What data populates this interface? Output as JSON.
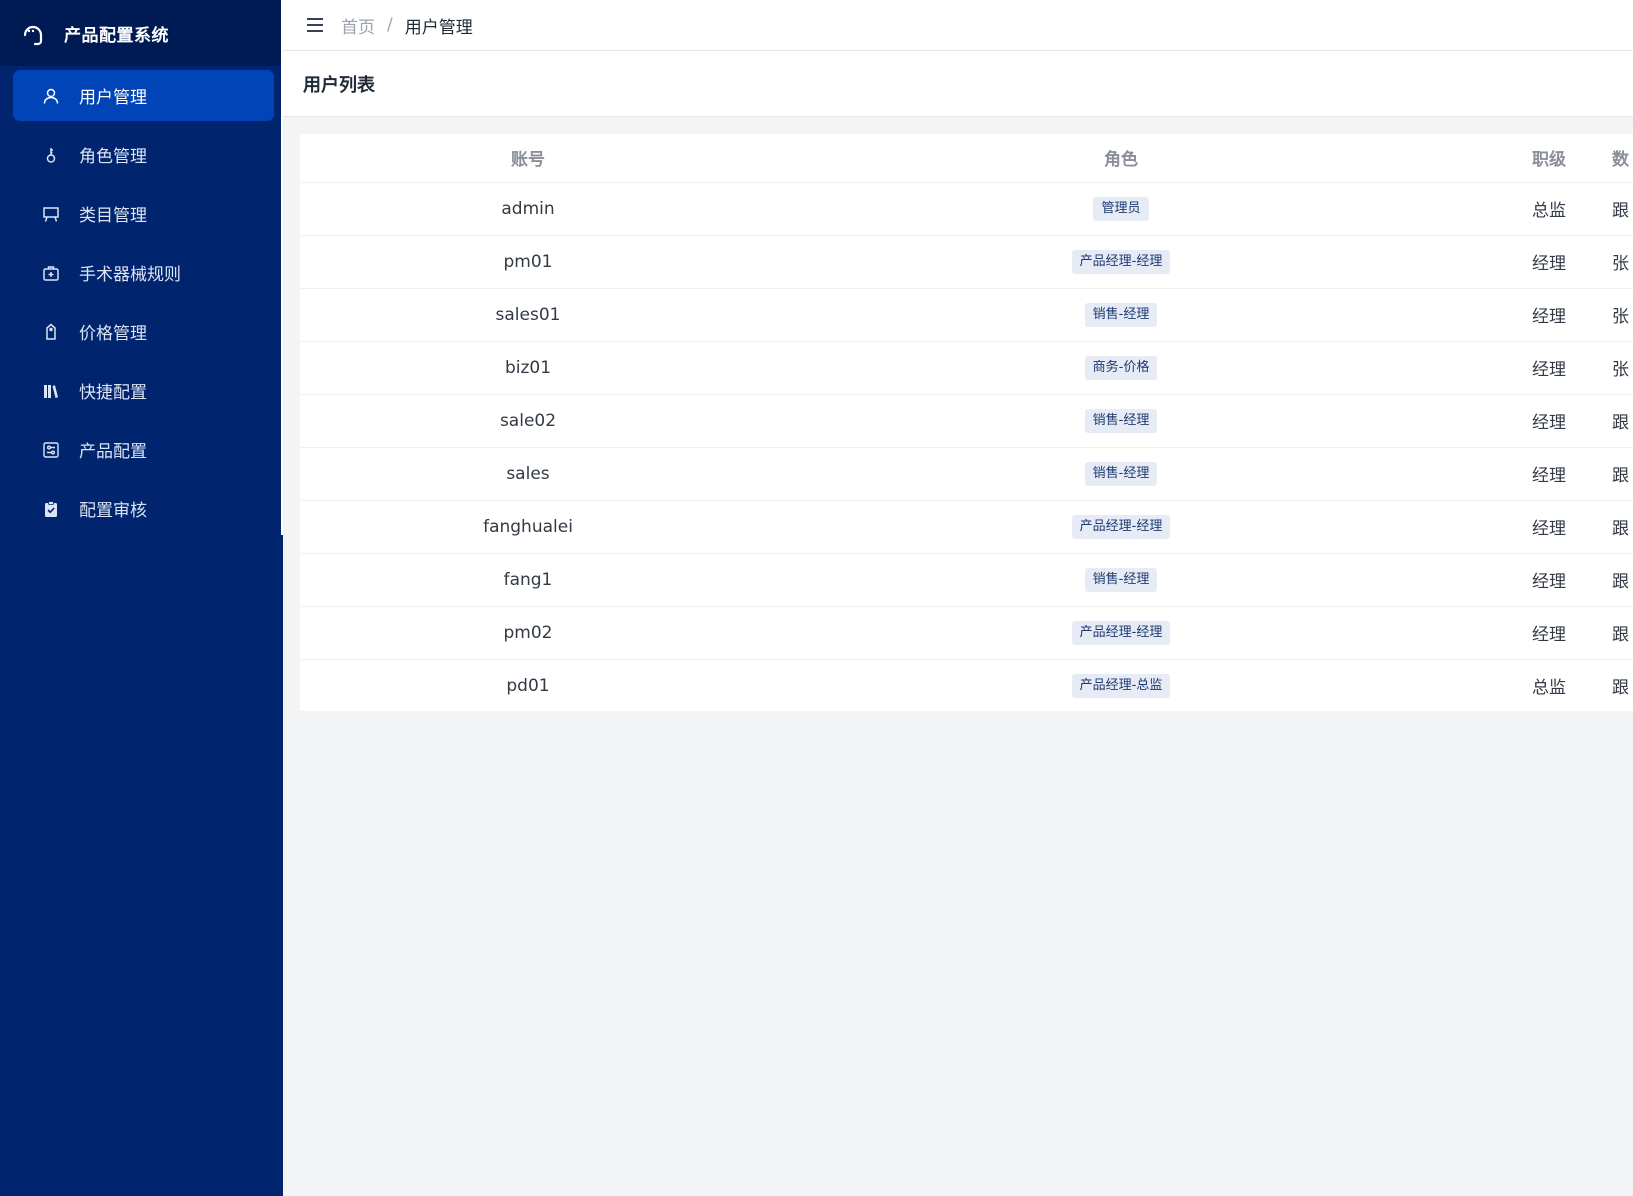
{
  "app": {
    "title": "产品配置系统"
  },
  "sidebar": {
    "items": [
      {
        "label": "用户管理",
        "icon": "user-icon",
        "active": true
      },
      {
        "label": "角色管理",
        "icon": "key-icon",
        "active": false
      },
      {
        "label": "类目管理",
        "icon": "easel-icon",
        "active": false
      },
      {
        "label": "手术器械规则",
        "icon": "medical-kit-icon",
        "active": false
      },
      {
        "label": "价格管理",
        "icon": "price-tag-icon",
        "active": false
      },
      {
        "label": "快捷配置",
        "icon": "books-icon",
        "active": false
      },
      {
        "label": "产品配置",
        "icon": "sliders-icon",
        "active": false
      },
      {
        "label": "配置审核",
        "icon": "clipboard-check-icon",
        "active": false
      }
    ]
  },
  "header": {
    "breadcrumb": {
      "home": "首页",
      "separator": "/",
      "current": "用户管理"
    }
  },
  "page": {
    "title": "用户列表"
  },
  "table": {
    "columns": [
      "账号",
      "角色",
      "职级",
      "数"
    ],
    "rows": [
      {
        "account": "admin",
        "role": "管理员",
        "level": "总监",
        "extra": "跟"
      },
      {
        "account": "pm01",
        "role": "产品经理-经理",
        "level": "经理",
        "extra": "张"
      },
      {
        "account": "sales01",
        "role": "销售-经理",
        "level": "经理",
        "extra": "张"
      },
      {
        "account": "biz01",
        "role": "商务-价格",
        "level": "经理",
        "extra": "张"
      },
      {
        "account": "sale02",
        "role": "销售-经理",
        "level": "经理",
        "extra": "跟"
      },
      {
        "account": "sales",
        "role": "销售-经理",
        "level": "经理",
        "extra": "跟"
      },
      {
        "account": "fanghualei",
        "role": "产品经理-经理",
        "level": "经理",
        "extra": "跟"
      },
      {
        "account": "fang1",
        "role": "销售-经理",
        "level": "经理",
        "extra": "跟"
      },
      {
        "account": "pm02",
        "role": "产品经理-经理",
        "level": "经理",
        "extra": "跟"
      },
      {
        "account": "pd01",
        "role": "产品经理-总监",
        "level": "总监",
        "extra": "跟"
      }
    ]
  },
  "colors": {
    "sidebar_bg": "#00246d",
    "brand_bg": "#001b54",
    "active_item_bg": "#0044b8",
    "role_tag_bg": "#e6ebf5",
    "role_tag_text": "#1e3a70"
  }
}
